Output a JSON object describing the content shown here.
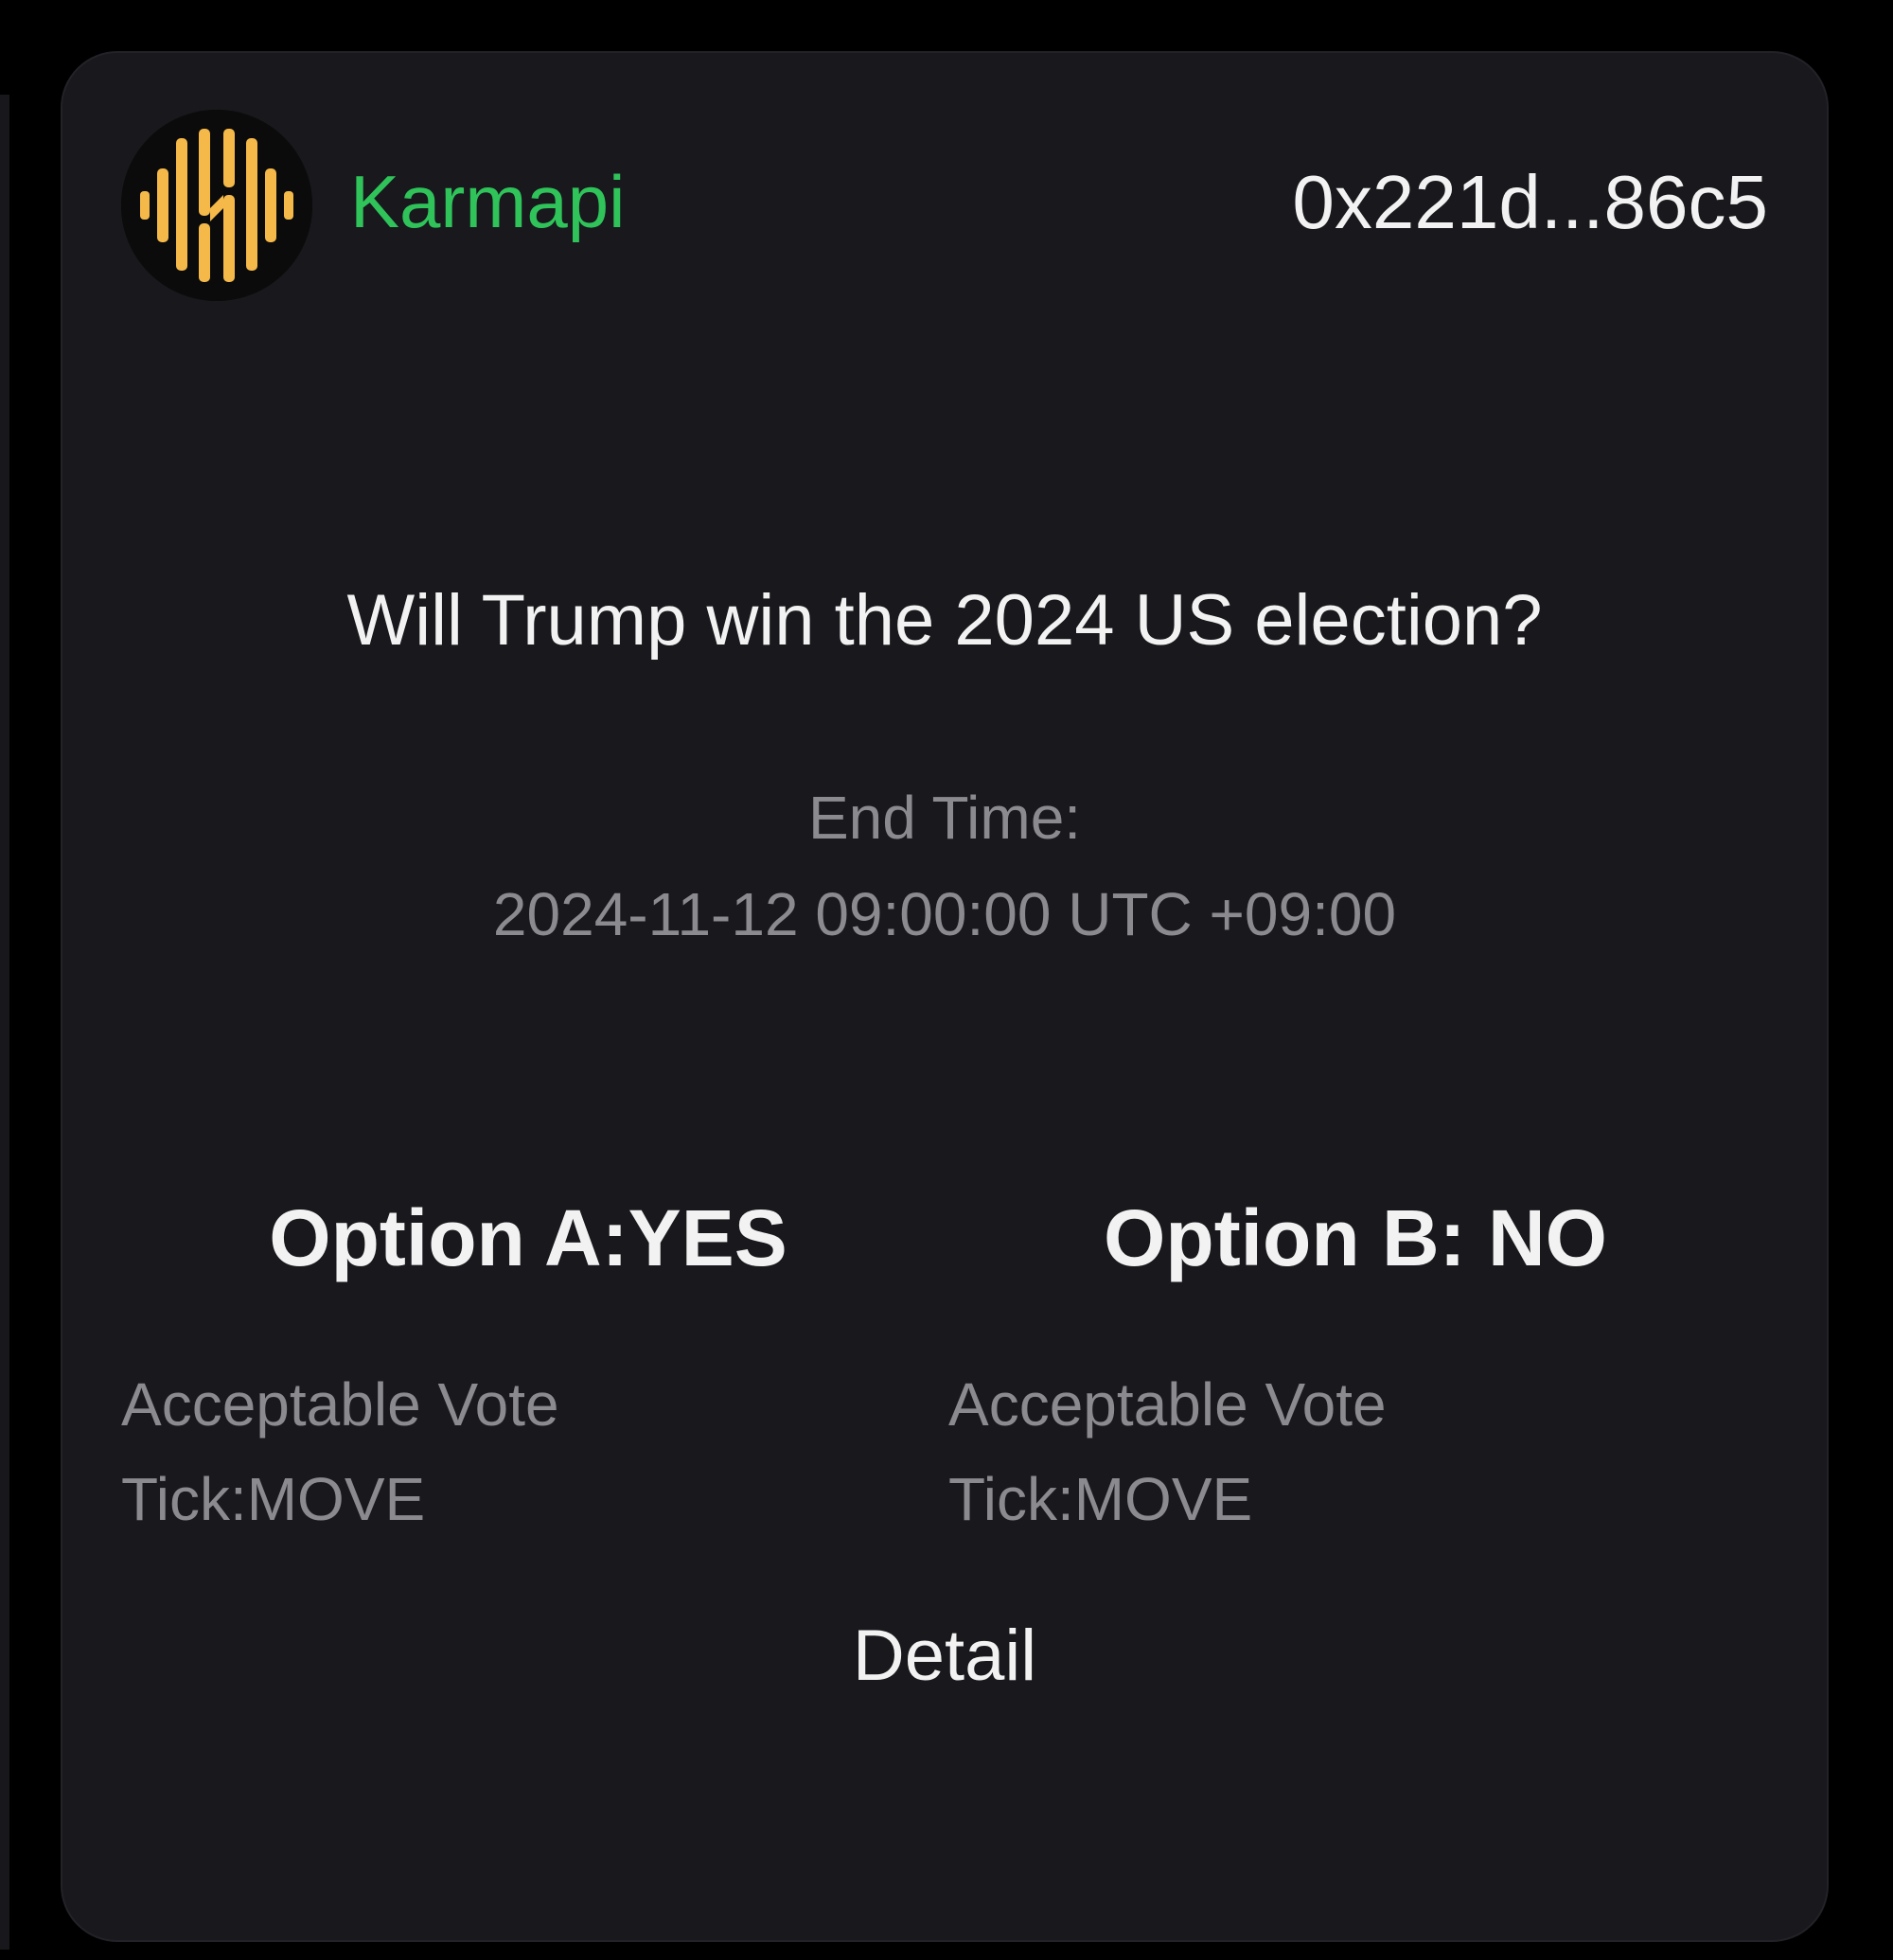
{
  "card": {
    "brand_name": "Karmapi",
    "wallet_address": "0x221d...86c5",
    "question": "Will Trump win the 2024 US election?",
    "end_time_label": "End Time:",
    "end_time_value": "2024-11-12 09:00:00 UTC +09:00",
    "options": [
      {
        "title": "Option A:YES",
        "desc_line1": "Acceptable Vote",
        "desc_line2": "Tick:MOVE"
      },
      {
        "title": "Option B: NO",
        "desc_line1": "Acceptable Vote",
        "desc_line2": "Tick:MOVE"
      }
    ],
    "detail_label": "Detail"
  },
  "colors": {
    "background": "#000000",
    "card": "#18181d",
    "brand_green": "#2fc35a",
    "logo_gold": "#f5b94a",
    "text_primary": "#f2f2f2",
    "text_muted": "#8b8b8f"
  },
  "icons": {
    "logo": "karmapi-logo-icon"
  }
}
